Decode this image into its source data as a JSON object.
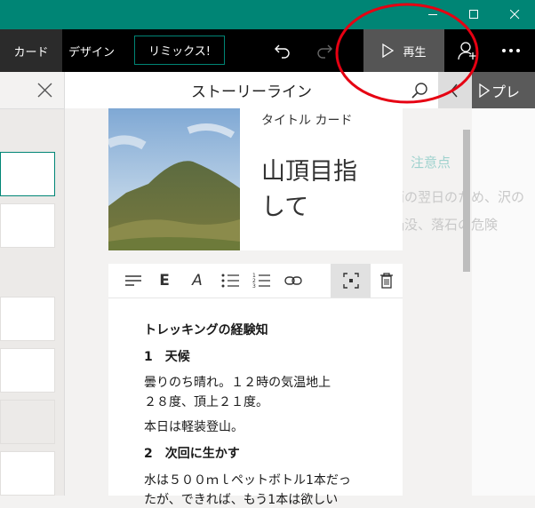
{
  "tabs": {
    "card": "カード",
    "design": "デザイン"
  },
  "remix": "リミックス!",
  "play_label": "再生",
  "story_title": "ストーリーライン",
  "right_preview": "プレ",
  "title_card": {
    "label": "タイトル カード",
    "title_line1": "山頂目指",
    "title_line2": "して"
  },
  "body": {
    "heading": "トレッキングの経験知",
    "s1": "1　天候",
    "p1_l1": "曇りのち晴れ。１２時の気温地上",
    "p1_l2": "２８度、頂上２１度。",
    "p2": "本日は軽装登山。",
    "s2": "2　次回に生かす",
    "p3": "水は５００ｍｌペットボトル1本だっ",
    "p3b": "たが、できれば、もう1本は欲しい"
  },
  "ghost": {
    "a": "注意点",
    "b": "雨の翌日のため、沢の",
    "c": "陥没、落石の危険"
  },
  "colors": {
    "accent": "#008575",
    "annotation": "#e60012"
  }
}
